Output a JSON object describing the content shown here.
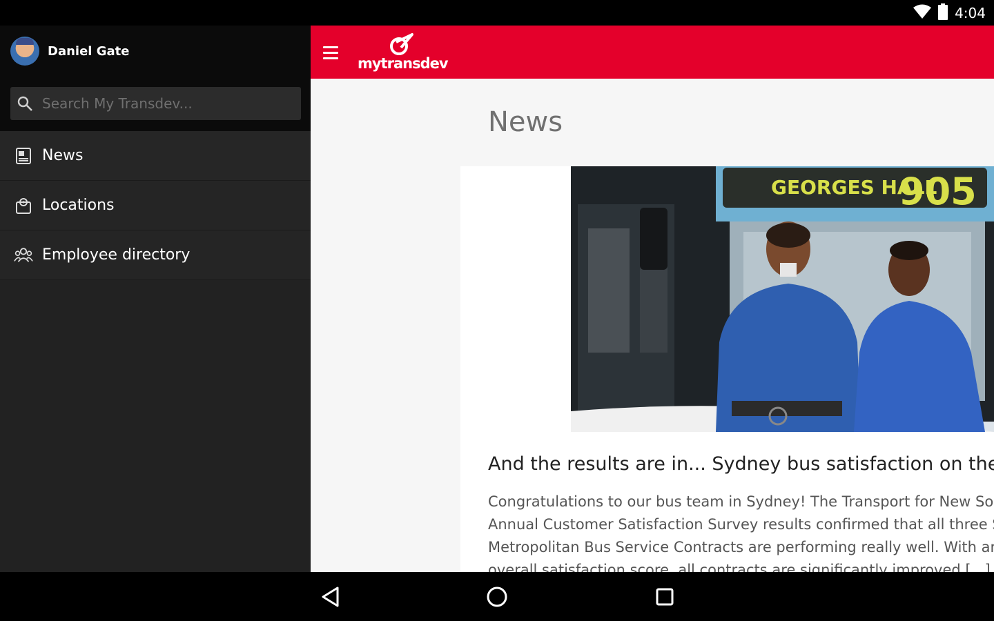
{
  "status_bar": {
    "time": "4:04",
    "icons": [
      "wifi-icon",
      "battery-icon"
    ]
  },
  "drawer": {
    "user_name": "Daniel Gate",
    "search_placeholder": "Search My Transdev...",
    "items": [
      {
        "label": "News",
        "icon": "news-icon"
      },
      {
        "label": "Locations",
        "icon": "locations-icon"
      },
      {
        "label": "Employee directory",
        "icon": "employee-directory-icon"
      }
    ]
  },
  "app_bar": {
    "brand": "mytransdev",
    "color": "#e4002b"
  },
  "main": {
    "page_title": "News",
    "article": {
      "title": "And the results are in... Sydney bus satisfaction on the",
      "body_lines": [
        "Congratulations to our bus team in Sydney! The Transport for New Sou",
        "Annual Customer Satisfaction Survey results confirmed that all three S",
        "Metropolitan Bus Service Contracts are performing really well. With an",
        "overall satisfaction score, all contracts are significantly improved [...]"
      ],
      "image": {
        "bus_sign": "GEORGES HALL",
        "bus_number": "905"
      }
    }
  },
  "nav_bar": {
    "buttons": [
      "back-button",
      "home-button",
      "recents-button"
    ]
  }
}
